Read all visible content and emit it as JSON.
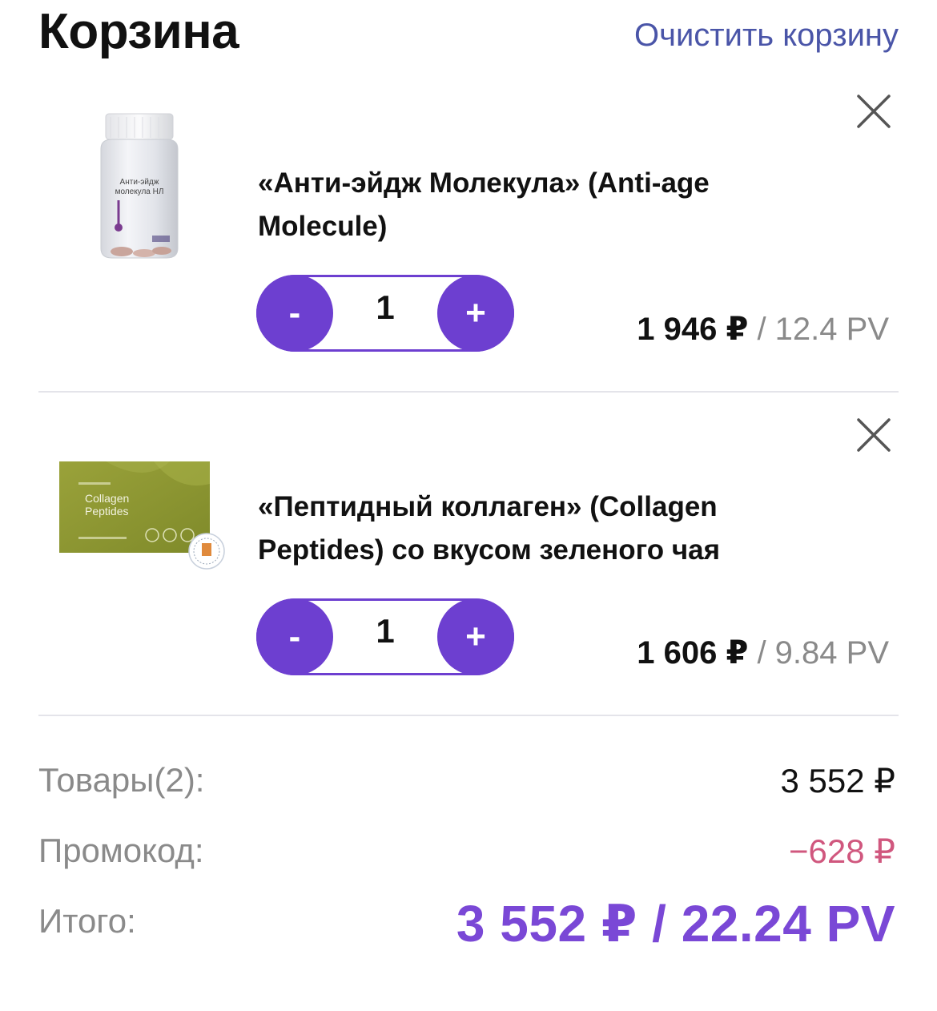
{
  "header": {
    "title": "Корзина",
    "clear_label": "Очистить корзину"
  },
  "items": [
    {
      "name": "«Анти-эйдж Молекула» (Anti-age Molecule)",
      "image_text": [
        "Анти-эйдж",
        "молекула НЛ"
      ],
      "quantity": "1",
      "minus_label": "-",
      "plus_label": "+",
      "price": "1 946 ₽",
      "separator": " / ",
      "pv": "12.4 PV"
    },
    {
      "name": "«Пептидный коллаген» (Collagen Peptides) со вкусом зеленого чая",
      "image_text": [
        "Collagen",
        "Peptides"
      ],
      "quantity": "1",
      "minus_label": "-",
      "plus_label": "+",
      "price": "1 606 ₽",
      "separator": " / ",
      "pv": "9.84 PV"
    }
  ],
  "summary": {
    "goods_label": "Товары(2):",
    "goods_value": "3 552 ₽",
    "promo_label": "Промокод:",
    "promo_value": "−628 ₽",
    "total_label": "Итого:",
    "total_value": "3 552 ₽ / 22.24 PV"
  },
  "colors": {
    "accent": "#6d3fd0",
    "link": "#4a55a8",
    "discount": "#d0577e",
    "total": "#7a48d6"
  },
  "icons": {
    "remove": "close-icon"
  }
}
